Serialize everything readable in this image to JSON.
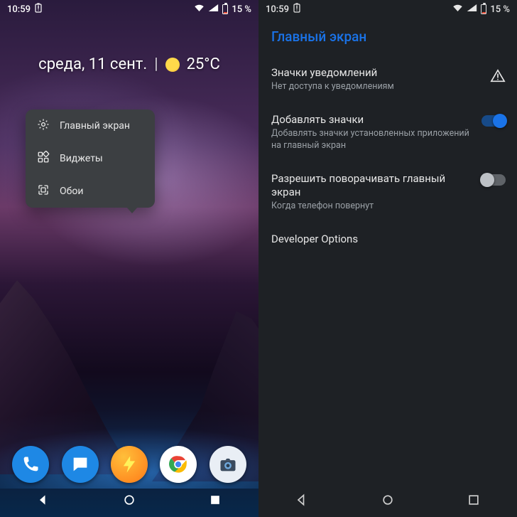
{
  "status": {
    "time": "10:59",
    "battery": "15 %"
  },
  "home": {
    "date": "среда, 11 сент.",
    "temperature": "25°C"
  },
  "popup": {
    "home_settings": "Главный экран",
    "widgets": "Виджеты",
    "wallpapers": "Обои"
  },
  "dock": {
    "phone": "Телефон",
    "messages": "Сообщения",
    "tasker": "Tasker",
    "chrome": "Chrome",
    "camera": "Камера"
  },
  "settings": {
    "title": "Главный экран",
    "notification_badges": {
      "title": "Значки уведомлений",
      "sub": "Нет доступа к уведомлениям"
    },
    "add_icons": {
      "title": "Добавлять значки",
      "sub": "Добавлять значки установленных приложений на главный экран",
      "enabled": true
    },
    "allow_rotation": {
      "title": "Разрешить поворачивать главный экран",
      "sub": "Когда телефон повернут",
      "enabled": false
    },
    "developer_options": {
      "title": "Developer Options"
    }
  }
}
